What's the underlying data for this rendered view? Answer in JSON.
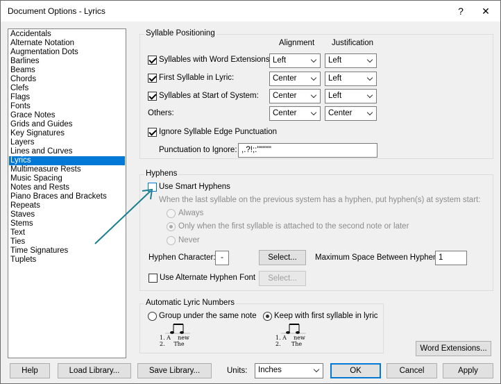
{
  "window": {
    "title": "Document Options - Lyrics",
    "help_glyph": "?",
    "close_glyph": "✕"
  },
  "categories": [
    "Accidentals",
    "Alternate Notation",
    "Augmentation Dots",
    "Barlines",
    "Beams",
    "Chords",
    "Clefs",
    "Flags",
    "Fonts",
    "Grace Notes",
    "Grids and Guides",
    "Key Signatures",
    "Layers",
    "Lines and Curves",
    "Lyrics",
    "Multimeasure Rests",
    "Music Spacing",
    "Notes and Rests",
    "Piano Braces and Brackets",
    "Repeats",
    "Staves",
    "Stems",
    "Text",
    "Ties",
    "Time Signatures",
    "Tuplets"
  ],
  "selected_category": "Lyrics",
  "syllable": {
    "group_title": "Syllable Positioning",
    "col_alignment": "Alignment",
    "col_justification": "Justification",
    "word_ext_label": "Syllables with Word Extensions:",
    "word_ext_alignment": "Left",
    "word_ext_justification": "Left",
    "first_label": "First Syllable in Lyric:",
    "first_alignment": "Center",
    "first_justification": "Left",
    "start_label": "Syllables at Start of System:",
    "start_alignment": "Center",
    "start_justification": "Left",
    "others_label": "Others:",
    "others_alignment": "Center",
    "others_justification": "Center",
    "ignore_edge_label": "Ignore Syllable Edge Punctuation",
    "punct_label": "Punctuation to Ignore:",
    "punct_value": ",.?!;:'\"\"\"\"'"
  },
  "hyphens": {
    "group_title": "Hyphens",
    "smart_label": "Use Smart Hyphens",
    "desc": "When the last syllable on the previous system has a hyphen, put hyphen(s) at system start:",
    "opt_always": "Always",
    "opt_only": "Only when the first syllable is attached to the second note or later",
    "opt_never": "Never",
    "char_label": "Hyphen Character:",
    "char_value": "-",
    "select_label": "Select...",
    "max_space_label": "Maximum Space Between Hyphens:",
    "max_space_value": "1",
    "alt_font_label": "Use Alternate Hyphen Font",
    "alt_select_label": "Select..."
  },
  "numbers": {
    "group_title": "Automatic Lyric Numbers",
    "group_under_label": "Group under the same note",
    "keep_with_label": "Keep with first syllable in lyric",
    "example_a_line1": "1. A    new",
    "example_a_line2": "2.     The",
    "example_b_line1": "1. A    new",
    "example_b_line2": "2.      The"
  },
  "word_ext_button": "Word Extensions...",
  "footer": {
    "help": "Help",
    "load_library": "Load Library...",
    "save_library": "Save Library...",
    "units_label": "Units:",
    "units_value": "Inches",
    "ok": "OK",
    "cancel": "Cancel",
    "apply": "Apply"
  },
  "colors": {
    "selection": "#0078d7",
    "annotation_arrow": "#1b7e8f"
  }
}
